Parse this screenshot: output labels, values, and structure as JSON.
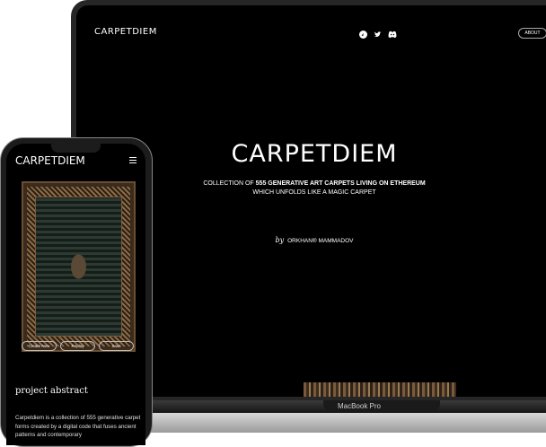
{
  "laptop": {
    "site": {
      "logo": "CARPETDIEM",
      "social_icons": [
        "opensea-icon",
        "twitter-icon",
        "discord-icon"
      ],
      "about_label": "ABOUT",
      "hero_title": "CARPETDIEM",
      "hero_line1_prefix": "COLLECTION OF ",
      "hero_line1_bold": "555 GENERATIVE ART CARPETS LIVING ON ETHEREUM",
      "hero_line2": "WHICH UNFOLDS LIKE A MAGIC CARPET",
      "by_word": "by",
      "author": "ORKHAN® MAMMADOV"
    },
    "base_label": "MacBook Pro"
  },
  "phone": {
    "logo": "CARPETDIEM",
    "menu_icon": "hamburger-icon",
    "buttons": [
      "Create New",
      "Replay",
      "Save"
    ],
    "abstract_title": "project abstract",
    "abstract_text": "Carpetdiem is a collection of 555 generative carpet forms created by a digital code that fuses ancient patterns and contemporary"
  },
  "colors": {
    "screen_bg": "#000000",
    "text": "#ffffff",
    "bezel": "#262626"
  }
}
